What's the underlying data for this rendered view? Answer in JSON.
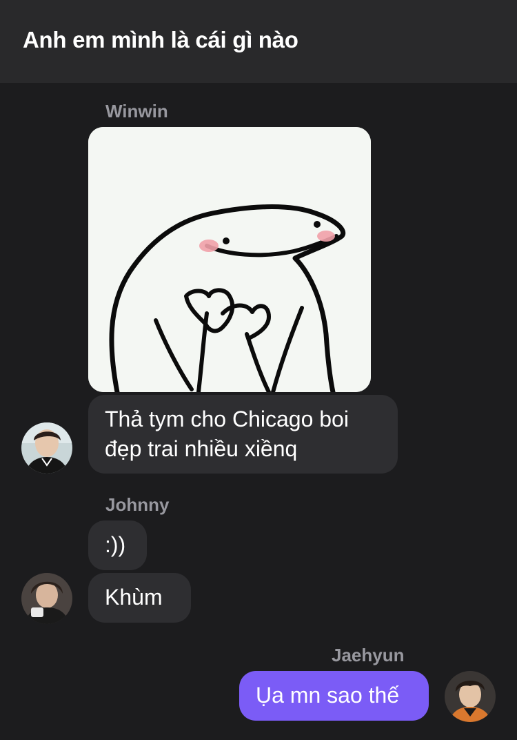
{
  "header": {
    "title": "Anh em mình là cái gì nào"
  },
  "messages": [
    {
      "sender": "Winwin",
      "image": {
        "description_icon": "blob-heart-sticker"
      },
      "text_line1": "Thả tym cho Chicago boi",
      "text_line2": "đẹp trai nhiều xiềnq"
    },
    {
      "sender": "Johnny",
      "text1": ":))",
      "text2": "Khùm"
    },
    {
      "sender": "Jaehyun",
      "text": "Ụa mn sao thế"
    }
  ],
  "colors": {
    "background": "#1c1c1e",
    "header": "#29292b",
    "incoming_bubble": "#2e2e31",
    "outgoing_bubble": "#7b5cf6",
    "sender_name": "#98989f"
  }
}
